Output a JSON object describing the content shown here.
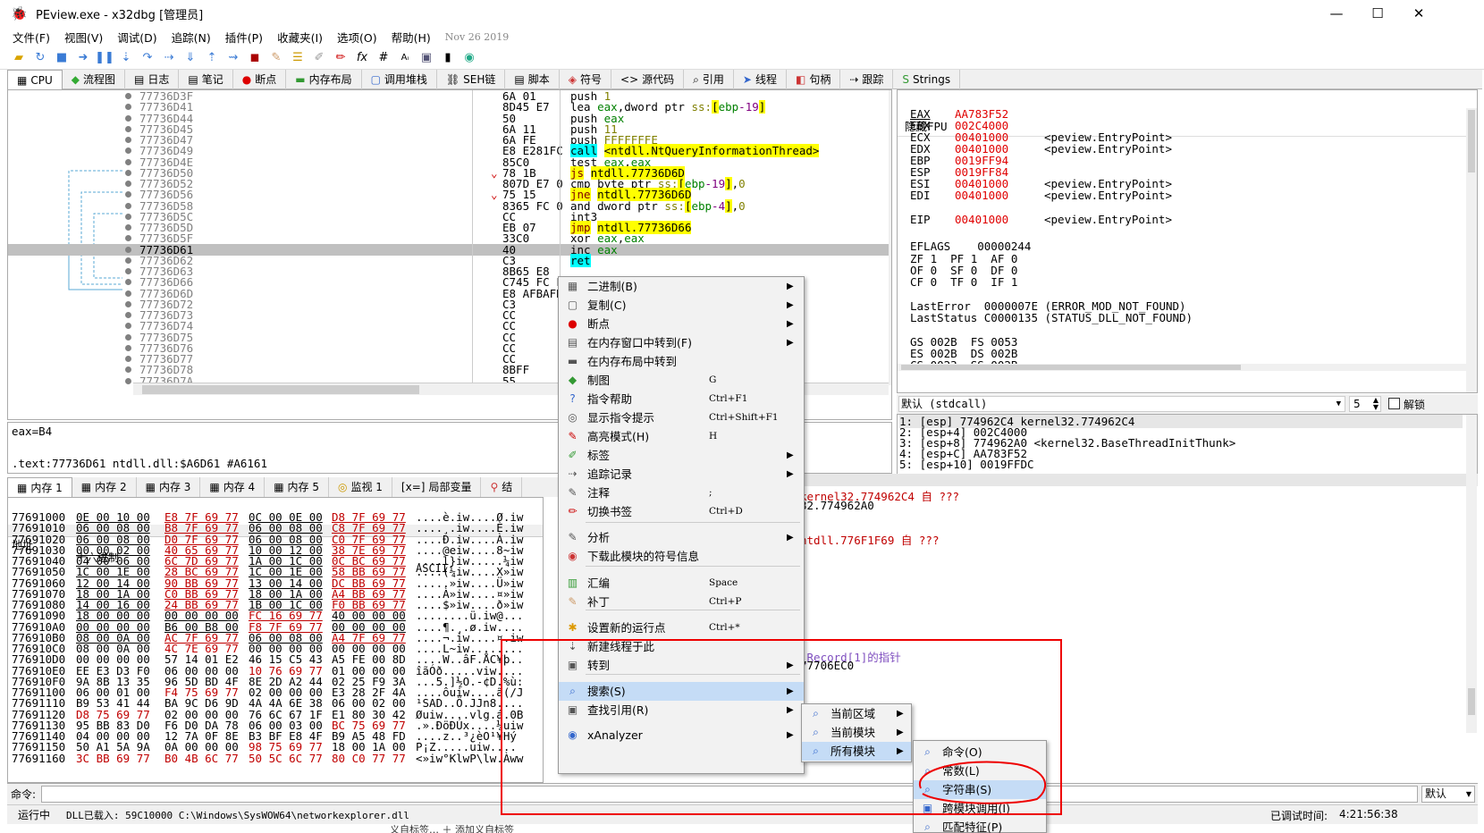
{
  "window": {
    "title": "PEview.exe - x32dbg [管理员]",
    "min": "—",
    "max": "☐",
    "close": "✕"
  },
  "menu": {
    "items": [
      "文件(F)",
      "视图(V)",
      "调试(D)",
      "追踪(N)",
      "插件(P)",
      "收藏夹(I)",
      "选项(O)",
      "帮助(H)"
    ],
    "date": "Nov 26 2019"
  },
  "toolbar_icons": [
    "open-icon",
    "restart-icon",
    "stop-icon",
    "run-icon",
    "pause-icon",
    "step-into-icon",
    "step-over-icon",
    "run-trace-icon",
    "trace-over-icon",
    "execute-till-return-icon",
    "run-user-icon",
    "script-icon",
    "patch-icon",
    "comment-icon",
    "label-icon",
    "bookmark-icon",
    "function-icon",
    "hash-icon",
    "font-icon",
    "calc-icon",
    "memory-icon",
    "web-icon"
  ],
  "tabs": [
    "CPU",
    "流程图",
    "日志",
    "笔记",
    "断点",
    "内存布局",
    "调用堆栈",
    "SEH链",
    "脚本",
    "符号",
    "源代码",
    "引用",
    "线程",
    "句柄",
    "跟踪",
    "Strings"
  ],
  "disasm": [
    {
      "addr": "77736D3F",
      "bytes": "6A 01",
      "ins": "push 1"
    },
    {
      "addr": "77736D41",
      "bytes": "8D45 E7",
      "ins": "lea eax,dword ptr ss:[ebp-19]"
    },
    {
      "addr": "77736D44",
      "bytes": "50",
      "ins": "push eax"
    },
    {
      "addr": "77736D45",
      "bytes": "6A 11",
      "ins": "push 11"
    },
    {
      "addr": "77736D47",
      "bytes": "6A FE",
      "ins": "push FFFFFFFE"
    },
    {
      "addr": "77736D49",
      "bytes": "E8 E281FC",
      "ins": "call <ntdll.NtQueryInformationThread>"
    },
    {
      "addr": "77736D4E",
      "bytes": "85C0",
      "ins": "test eax,eax"
    },
    {
      "addr": "77736D50",
      "bytes": "78 1B",
      "ins": "js ntdll.77736D6D"
    },
    {
      "addr": "77736D52",
      "bytes": "807D E7 0",
      "ins": "cmp byte ptr ss:[ebp-19],0"
    },
    {
      "addr": "77736D56",
      "bytes": "75 15",
      "ins": "jne ntdll.77736D6D"
    },
    {
      "addr": "77736D58",
      "bytes": "8365 FC 0",
      "ins": "and dword ptr ss:[ebp-4],0"
    },
    {
      "addr": "77736D5C",
      "bytes": "CC",
      "ins": "int3"
    },
    {
      "addr": "77736D5D",
      "bytes": "EB 07",
      "ins": "jmp ntdll.77736D66"
    },
    {
      "addr": "77736D5F",
      "bytes": "33C0",
      "ins": "xor eax,eax"
    },
    {
      "addr": "77736D61",
      "bytes": "40",
      "ins": "inc eax"
    },
    {
      "addr": "77736D62",
      "bytes": "C3",
      "ins": "ret"
    },
    {
      "addr": "77736D63",
      "bytes": "8B65 E8",
      "ins": ""
    },
    {
      "addr": "77736D66",
      "bytes": "C745 FC F",
      "ins": ""
    },
    {
      "addr": "77736D6D",
      "bytes": "E8 AFBAFD",
      "ins": ""
    },
    {
      "addr": "77736D72",
      "bytes": "C3",
      "ins": ""
    },
    {
      "addr": "77736D73",
      "bytes": "CC",
      "ins": ""
    },
    {
      "addr": "77736D74",
      "bytes": "CC",
      "ins": ""
    },
    {
      "addr": "77736D75",
      "bytes": "CC",
      "ins": ""
    },
    {
      "addr": "77736D76",
      "bytes": "CC",
      "ins": ""
    },
    {
      "addr": "77736D77",
      "bytes": "CC",
      "ins": ""
    },
    {
      "addr": "77736D78",
      "bytes": "8BFF",
      "ins": ""
    },
    {
      "addr": "77736D7A",
      "bytes": "55",
      "ins": ""
    }
  ],
  "registers": {
    "header": "隐藏FPU",
    "rows": [
      {
        "n": "EAX",
        "v": "AA783F52",
        "c": ""
      },
      {
        "n": "EBX",
        "v": "002C4000",
        "c": ""
      },
      {
        "n": "ECX",
        "v": "00401000",
        "c": "<peview.EntryPoint>"
      },
      {
        "n": "EDX",
        "v": "00401000",
        "c": "<peview.EntryPoint>"
      },
      {
        "n": "EBP",
        "v": "0019FF94",
        "c": ""
      },
      {
        "n": "ESP",
        "v": "0019FF84",
        "c": ""
      },
      {
        "n": "ESI",
        "v": "00401000",
        "c": "<peview.EntryPoint>"
      },
      {
        "n": "EDI",
        "v": "00401000",
        "c": "<peview.EntryPoint>"
      },
      {
        "n": "EIP",
        "v": "00401000",
        "c": "<peview.EntryPoint>"
      }
    ],
    "eflags": "EFLAGS    00000244",
    "flags1": "ZF 1  PF 1  AF 0",
    "flags2": "OF 0  SF 0  DF 0",
    "flags3": "CF 0  TF 0  IF 1",
    "lasterror": "LastError  0000007E (ERROR_MOD_NOT_FOUND)",
    "laststatus": "LastStatus C0000135 (STATUS_DLL_NOT_FOUND)",
    "seg1": "GS 002B  FS 0053",
    "seg2": "ES 002B  DS 002B",
    "seg3": "CS 0023  SS 002B"
  },
  "callconv": {
    "value": "默认 (stdcall)",
    "count": "5",
    "unlock": "解锁"
  },
  "args": [
    "1: [esp] 774962C4 kernel32.774962C4",
    "2: [esp+4] 002C4000",
    "3: [esp+8] 774962A0 <kernel32.BaseThreadInitThunk>",
    "4: [esp+C] AA783F52",
    "5: [esp+10] 0019FFDC"
  ],
  "info": {
    "line1": "eax=B4",
    "line2": ".text:77736D61 ntdll.dll:$A6D61 #A6161"
  },
  "lower_tabs": [
    "内存 1",
    "内存 2",
    "内存 3",
    "内存 4",
    "内存 5",
    "监视 1",
    "局部变量",
    "结"
  ],
  "dump": {
    "hdr_addr": "地址",
    "hdr_hex": "十六进制",
    "hdr_ascii": "ASCII",
    "rows": [
      [
        "77691000",
        "0E 00 10 00",
        "E8 7F 69 77",
        "0C 00 0E 00",
        "D8 7F 69 77",
        "....è.iw....Ø.iw"
      ],
      [
        "77691010",
        "06 00 08 00",
        "B8 7F 69 77",
        "06 00 08 00",
        "C8 7F 69 77",
        "....¸.iw....È.iw"
      ],
      [
        "77691020",
        "06 00 08 00",
        "D0 7F 69 77",
        "06 00 08 00",
        "C0 7F 69 77",
        "....Ð.iw....À.iw"
      ],
      [
        "77691030",
        "00 00 02 00",
        "40 65 69 77",
        "10 00 12 00",
        "38 7E 69 77",
        "....@eiw....8~iw"
      ],
      [
        "77691040",
        "04 00 06 00",
        "6C 7D 69 77",
        "1A 00 1C 00",
        "0C BC 69 77",
        "....l}iw.....¼iw"
      ],
      [
        "77691050",
        "1C 00 1E 00",
        "28 BC 69 77",
        "1C 00 1E 00",
        "58 BB 69 77",
        "....(¼iw....X»iw"
      ],
      [
        "77691060",
        "12 00 14 00",
        "90 BB 69 77",
        "13 00 14 00",
        "DC BB 69 77",
        ".....»iw....Ü»iw"
      ],
      [
        "77691070",
        "18 00 1A 00",
        "C0 BB 69 77",
        "18 00 1A 00",
        "A4 BB 69 77",
        "....À»iw....¤»iw"
      ],
      [
        "77691080",
        "14 00 16 00",
        "24 BB 69 77",
        "1B 00 1C 00",
        "F0 BB 69 77",
        "....$»iw....ð»iw"
      ],
      [
        "77691090",
        "18 00 00 00",
        "00 00 00 00",
        "FC 16 69 77",
        "40 00 00 00",
        "........ü.iw@..."
      ],
      [
        "776910A0",
        "00 00 00 00",
        "B6 00 B8 00",
        "F8 7F 69 77",
        "00 00 00 00",
        "....¶.¸.ø.iw...."
      ],
      [
        "776910B0",
        "08 00 0A 00",
        "AC 7F 69 77",
        "06 00 08 00",
        "A4 7F 69 77",
        "....¬.iw....¤.iw"
      ],
      [
        "776910C0",
        "08 00 0A 00",
        "4C 7E 69 77",
        "00 00 00 00",
        "00 00 00 00",
        "....L~iw........"
      ],
      [
        "776910D0",
        "00 00 00 00",
        "57 14 01 E2",
        "46 15 C5 43",
        "A5 FE 00 8D",
        "....W..âF.ÅC¥þ.."
      ],
      [
        "776910E0",
        "EE E3 D3 F0",
        "06 00 00 00",
        "10 76 69 77",
        "01 00 00 00",
        "îãÓð.....viw...."
      ],
      [
        "776910F0",
        "9A 8B 13 35",
        "96 5D BD 4F",
        "8E 2D A2 44",
        "02 25 F9 3A",
        "...5.]½O.-¢D.%ù:"
      ],
      [
        "77691100",
        "06 00 01 00",
        "F4 75 69 77",
        "02 00 00 00",
        "E3 28 2F 4A",
        "....ôuiw....ã(/J"
      ],
      [
        "77691110",
        "B9 53 41 44",
        "BA 9C D6 9D",
        "4A 4A 6E 38",
        "06 00 02 00",
        "¹SAD..Ö.JJn8...."
      ],
      [
        "77691120",
        "D8 75 69 77",
        "02 00 00 00",
        "76 6C 67 1F",
        "E1 80 30 42",
        "Øuiw....vlg.á.0B"
      ],
      [
        "77691130",
        "95 BB 83 D0",
        "F6 D0 DA 78",
        "06 00 03 00",
        "BC 75 69 77",
        ".».ÐöÐÚx....¼uiw"
      ],
      [
        "77691140",
        "04 00 00 00",
        "12 7A 0F 8E",
        "B3 BF E8 4F",
        "B9 A5 48 FD",
        "....z..³¿èO¹¥Hý"
      ],
      [
        "77691150",
        "50 A1 5A 9A",
        "0A 00 00 00",
        "98 75 69 77",
        "18 00 1A 00",
        "P¡Z.....uiw...."
      ],
      [
        "77691160",
        "3C BB 69 77",
        "B0 4B 6C 77",
        "50 5C 6C 77",
        "80 C0 77 77",
        "<»iw°KlwP\\lw.Àww"
      ]
    ]
  },
  "stack": {
    "line1": "kernel32.774962C4 自 ???",
    "line2": "32.774962A0",
    "line3": "ntdll.776F1F69 自 ???",
    "line4": "_Record[1]的指针",
    "line5": "77706EC0"
  },
  "command": {
    "label": "命令:",
    "placeholder": "",
    "mode": "默认"
  },
  "status": {
    "state": "运行中",
    "msg": "DLL已载入: 59C10000 C:\\Windows\\SysWOW64\\networkexplorer.dll",
    "time_label": "已调试时间:",
    "time": "4:21:56:38"
  },
  "context_menu": {
    "items": [
      {
        "label": "二进制(B)",
        "sc": "",
        "sub": true,
        "icon": "binary-icon"
      },
      {
        "label": "复制(C)",
        "sc": "",
        "sub": true,
        "icon": "copy-icon"
      },
      {
        "label": "断点",
        "sc": "",
        "sub": true,
        "icon": "breakpoint-icon"
      },
      {
        "label": "在内存窗口中转到(F)",
        "sc": "",
        "sub": true,
        "icon": "memory-goto-icon"
      },
      {
        "label": "在内存布局中转到",
        "sc": "",
        "sub": false,
        "icon": "memmap-icon"
      },
      {
        "label": "制图",
        "sc": "G",
        "sub": false,
        "icon": "graph-icon"
      },
      {
        "label": "指令帮助",
        "sc": "Ctrl+F1",
        "sub": false,
        "icon": "help-icon"
      },
      {
        "label": "显示指令提示",
        "sc": "Ctrl+Shift+F1",
        "sub": false,
        "icon": "hint-icon"
      },
      {
        "label": "高亮模式(H)",
        "sc": "H",
        "sub": false,
        "icon": "highlight-icon"
      },
      {
        "label": "标签",
        "sc": "",
        "sub": true,
        "icon": "label-icon"
      },
      {
        "label": "追踪记录",
        "sc": "",
        "sub": true,
        "icon": "trace-icon"
      },
      {
        "label": "注释",
        "sc": ";",
        "sub": false,
        "icon": "comment-icon"
      },
      {
        "label": "切换书签",
        "sc": "Ctrl+D",
        "sub": false,
        "icon": "bookmark-icon"
      },
      {
        "label": "分析",
        "sc": "",
        "sub": true,
        "icon": "analyze-icon"
      },
      {
        "label": "下载此模块的符号信息",
        "sc": "",
        "sub": false,
        "icon": "download-symbols-icon"
      },
      {
        "label": "汇编",
        "sc": "Space",
        "sub": false,
        "icon": "assemble-icon"
      },
      {
        "label": "补丁",
        "sc": "Ctrl+P",
        "sub": false,
        "icon": "patch-icon"
      },
      {
        "label": "设置新的运行点",
        "sc": "Ctrl+*",
        "sub": false,
        "icon": "new-origin-icon"
      },
      {
        "label": "新建线程于此",
        "sc": "",
        "sub": false,
        "icon": "new-thread-icon"
      },
      {
        "label": "转到",
        "sc": "",
        "sub": true,
        "icon": "goto-icon"
      },
      {
        "label": "搜索(S)",
        "sc": "",
        "sub": true,
        "icon": "search-icon"
      },
      {
        "label": "查找引用(R)",
        "sc": "",
        "sub": true,
        "icon": "find-references-icon"
      },
      {
        "label": "xAnalyzer",
        "sc": "",
        "sub": true,
        "icon": "xanalyzer-icon"
      }
    ]
  },
  "submenu1": {
    "items": [
      "当前区域",
      "当前模块",
      "所有模块"
    ]
  },
  "submenu2": {
    "items": [
      "命令(O)",
      "常数(L)",
      "字符串(S)",
      "跨模块调用(I)",
      "匹配特征(P)"
    ]
  },
  "behind": {
    "text": "义自标签… ＋ 添加义自标签"
  }
}
